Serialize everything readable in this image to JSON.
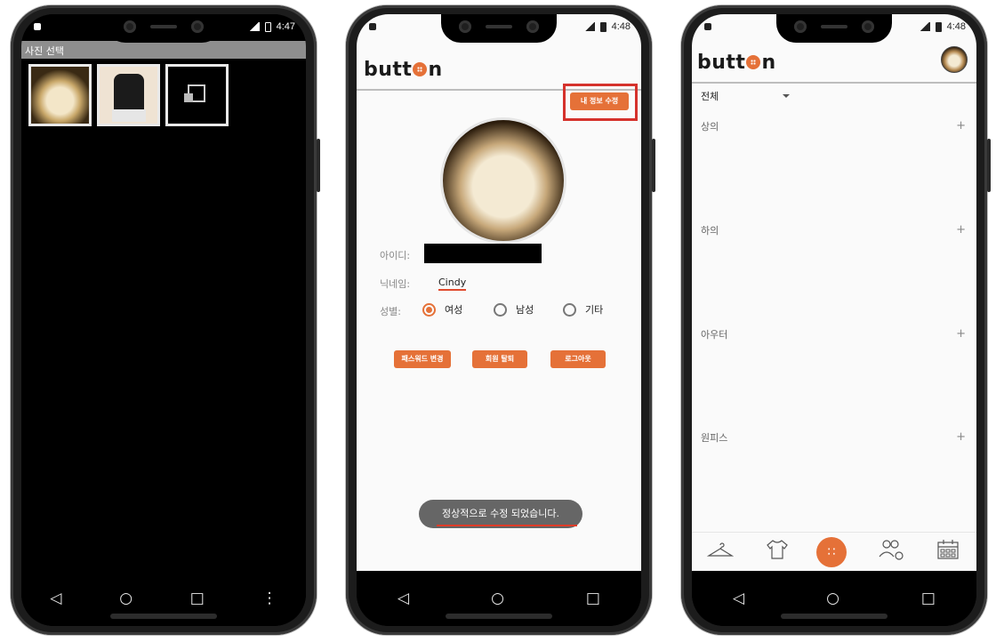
{
  "phone1": {
    "status_time": "4:47",
    "title": "사진 선택",
    "thumbnails": [
      "cat-photo",
      "shirt-photo",
      "broken-image-icon"
    ]
  },
  "phone2": {
    "status_time": "4:48",
    "logo": "butt n",
    "edit_button": "내 정보 수정",
    "id_label": "아이디:",
    "nickname_label": "닉네임:",
    "nickname_value": "Cindy",
    "gender_label": "성별:",
    "gender_options": [
      "여성",
      "남성",
      "기타"
    ],
    "gender_selected": "여성",
    "btn_password": "패스워드 변경",
    "btn_withdraw": "회원 탈퇴",
    "btn_logout": "로그아웃",
    "toast": "정상적으로 수정 되었습니다."
  },
  "phone3": {
    "status_time": "4:48",
    "logo": "butt n",
    "filter": "전체",
    "categories": [
      "상의",
      "하의",
      "아우터",
      "원피스"
    ],
    "plus": "+",
    "tabs": [
      "hanger-icon",
      "shirt-icon",
      "grid-dots-icon",
      "people-add-icon",
      "calendar-icon"
    ]
  },
  "nav": {
    "back": "◁",
    "home": "○",
    "recents": "□",
    "more": "⋮"
  },
  "colors": {
    "accent": "#e57138",
    "highlight": "#d5322c"
  }
}
